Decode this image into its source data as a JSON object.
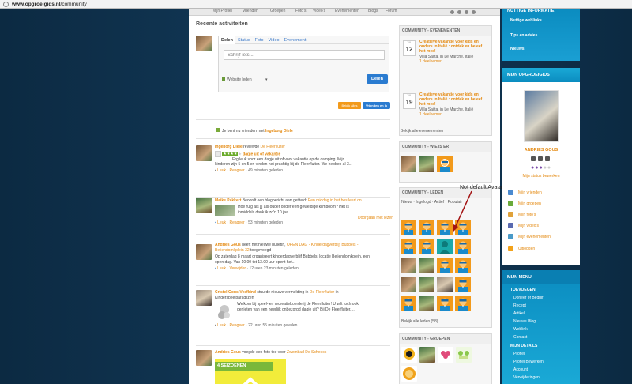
{
  "browser": {
    "url_host": "www.opgroeigids.nl",
    "url_path": "/community"
  },
  "topnav": [
    "Mijn Profiel",
    "Vrienden",
    "Groepen",
    "Foto's",
    "Video's",
    "Evenementen",
    "Blogs",
    "Forum"
  ],
  "activity": {
    "title": "Recente activiteiten",
    "tabs": [
      "Delen",
      "Status",
      "Foto",
      "Video",
      "Evenement"
    ],
    "placeholder": "Schrijf iets...",
    "privacy": "Website leden",
    "share_button": "Delen",
    "filter_all": "Bekijk alles",
    "filter_friends": "Vrienden en Ik"
  },
  "feed": {
    "f1_text": "Je bent nu vrienden met",
    "f1_name": "Ingeborg Diele",
    "f2_name": "Ingeborg Diele",
    "f2_action": "reviewde",
    "f2_target": "De Fleerfluiter",
    "f2_rating_text": "dagje uit of vakantie",
    "f2_body_1": "Erg leuk voor een dagje uit of voor vakantie op de camping. Mijn",
    "f2_body_2": "kinderen zijn 5 en 5 en vinden het prachtig bij de Fleerfluiter. We hebben al 3...",
    "f2_like": "Leuk",
    "f2_react": "Reageer",
    "f2_time": "49 minuten geleden",
    "f3_name": "Maike Pakkert",
    "f3_action": "Beoordt een blogbericht aan getiteld:",
    "f3_target": "Een middag in het bos leert on...",
    "f3_body_1": "Hoe ruig als jij als ouder onder een geweldige klimboom? Het is",
    "f3_body_2": "inmiddels dank ik zo'n 10 jaa ...",
    "f3_more": "Doorgaan met lezen",
    "f3_like": "Leuk",
    "f3_react": "Reageer",
    "f3_time": "53 minuten geleden",
    "f4_name": "Andries Gous",
    "f4_action": "heeft het nieuwe bulletin,",
    "f4_target": "OPEN DAG - Kinderdagverblijf Bubbels -",
    "f4_target2": "Beliendomkplein 32",
    "f4_action2": "toegevoegd",
    "f4_body_1": "Op zaterdag 8 maart organiseert kinderdagverblijf Bubbels, locatie Beliendomkplein, een",
    "f4_body_2": "open dag. Van 10.00 tot 13.00 uur opent het...",
    "f4_like": "Leuk",
    "f4_react": "Verwijder",
    "f4_time": "12 uren 23 minuten geleden",
    "f5_name": "Cristel Gous-Veefkind",
    "f5_action": "stuurde nieuwe vermelding in",
    "f5_target": "De Fleerfluiter",
    "f5_action2": "in",
    "f5_cat": "Kinderspeelparadijzen",
    "f5_body_1": "Welkom bij speel- en recreatieboerderij de Fleerfluiter! U wilt toch ook",
    "f5_body_2": "genieten van een heerlijk onbezorgd dagje uit? Bij De Fleerfluiter....",
    "f5_like": "Leuk",
    "f5_react": "Reageer",
    "f5_time": "22 uren 55 minuten geleden",
    "f6_name": "Andries Gous",
    "f6_action": "voegde een foto toe voor",
    "f6_target": "Zwembad De Scheeck",
    "f6_banner": "4 SEIZOENEN"
  },
  "events": {
    "header": "COMMUNITY - EVENEMENTEN",
    "items": [
      {
        "month": "JUL",
        "day": "12",
        "title_1": "Creatieve vakantie voor kids en",
        "title_2": "ouders in Italië : ontdek en beleef",
        "title_3": "het mes!",
        "place": "Villa Sailta, in Le Marche, Italië",
        "count": "1 deelnemer"
      },
      {
        "month": "JUL",
        "day": "19",
        "title_1": "Creatieve vakantie voor kids en",
        "title_2": "ouders in Italië : ontdek en beleef",
        "title_3": "het mes!",
        "place": "Villa Sailta, in Le Marche, Italië",
        "count": "1 deelnemer"
      }
    ],
    "all": "Bekijk alle evenementen"
  },
  "who": {
    "header": "COMMUNITY - WIE IS ER"
  },
  "members": {
    "header": "COMMUNITY - LEDEN",
    "filters": "Nieuw · Ingelogd · Actief · Populair",
    "all": "Bekijk alle leden (58)"
  },
  "groups": {
    "header": "COMMUNITY - GROEPEN"
  },
  "annotation": "Not default Avatar",
  "right": {
    "top_header": "NUTTIGE INFORMATIE",
    "top_items": [
      "Nuttige weblinks",
      "Tips en advies",
      "Nieuws"
    ],
    "profile_header": "MIJN OPGROEIGIDS",
    "profile_name": "ANDRIES GOUS",
    "status_edit": "Mijn status bewerken",
    "links": [
      "Mijn vrienden",
      "Mijn groepen",
      "Mijn foto's",
      "Mijn video's",
      "Mijn evenementen",
      "Uitloggen"
    ],
    "menu_header": "MIJN MENU",
    "menu_sub1": "TOEVOEGEN",
    "menu_items1": [
      "Doneer of Bedrijf",
      "Recept",
      "Artikel",
      "Nieuwe Blog",
      "Weblink",
      "Contact"
    ],
    "menu_sub2": "MIJN DETAILS",
    "menu_items2": [
      "Profiel",
      "Profiel Bewerken",
      "Account",
      "Verwijderingen"
    ]
  },
  "colors": {
    "accent": "#e48a12",
    "blue": "#2a7bd0",
    "header_blue": "#0b8cc0",
    "background": "#0e2e47"
  }
}
